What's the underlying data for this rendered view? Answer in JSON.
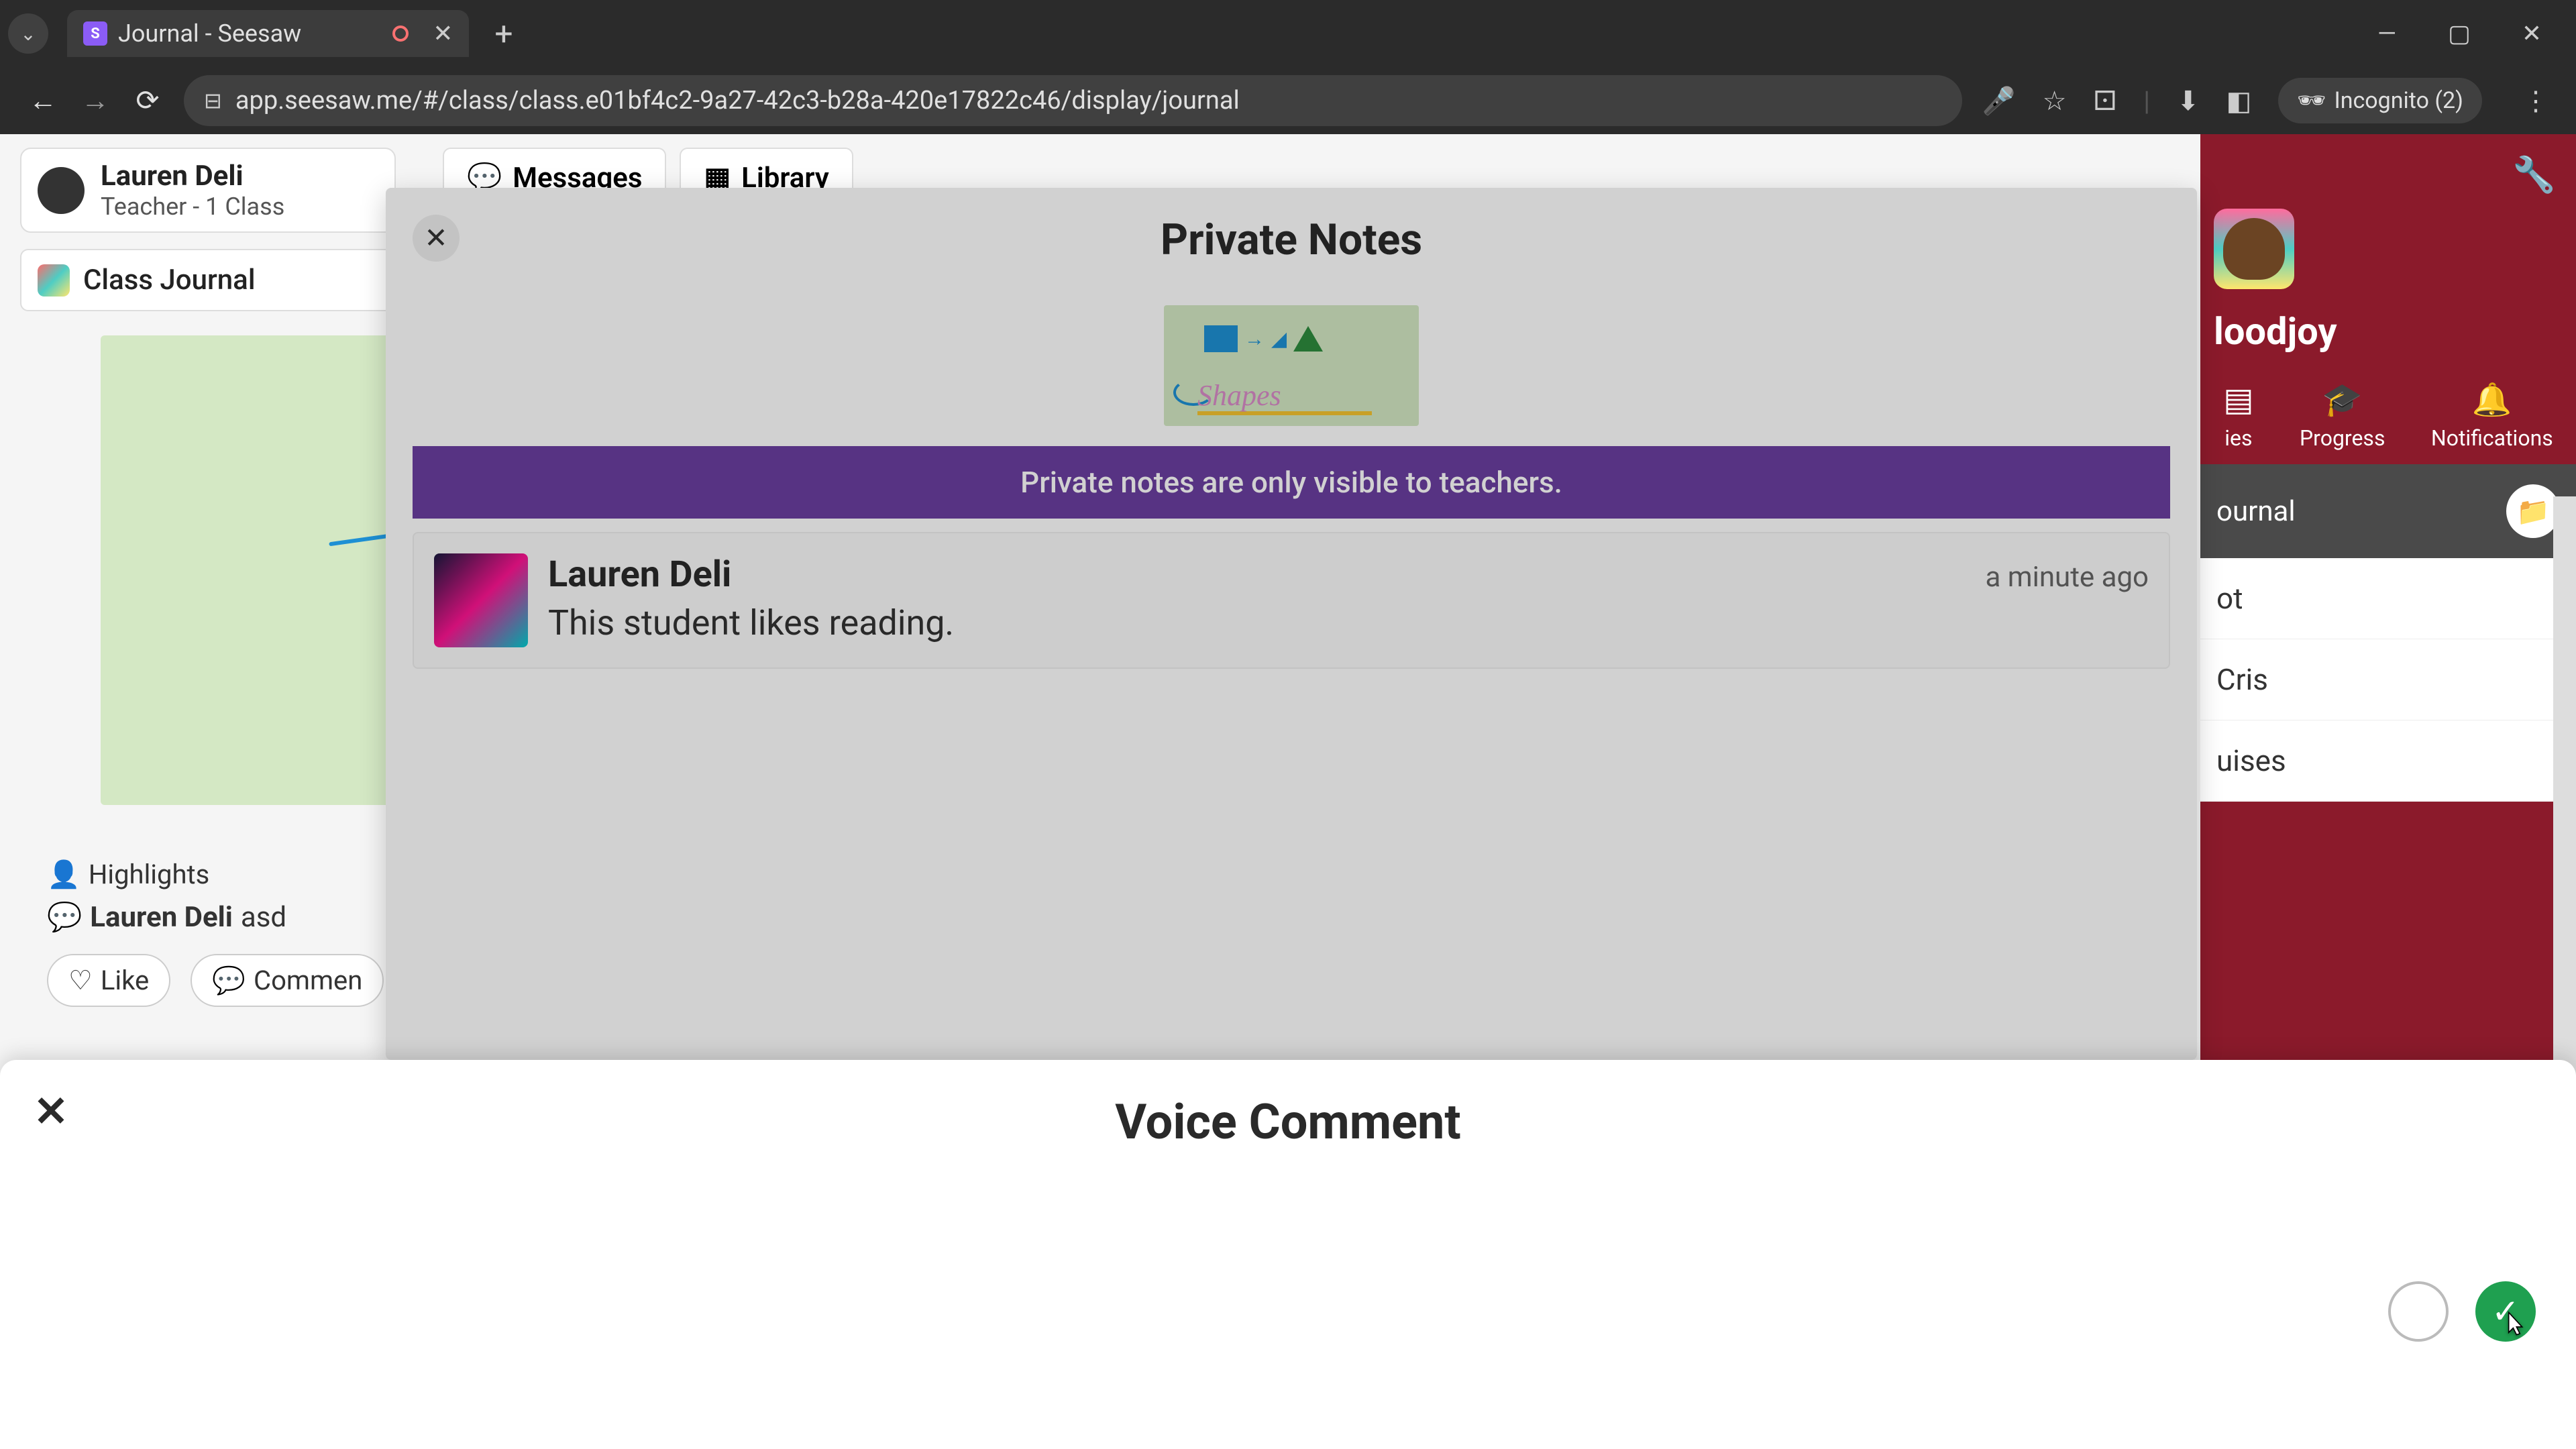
{
  "browser": {
    "tab_title": "Journal - Seesaw",
    "url": "app.seesaw.me/#/class/class.e01bf4c2-9a27-42c3-b28a-420e17822c46/display/journal",
    "incognito_label": "Incognito (2)"
  },
  "user": {
    "name": "Lauren Deli",
    "role": "Teacher - 1 Class"
  },
  "journal_label": "Class Journal",
  "top_tabs": {
    "messages": "Messages",
    "library": "Library"
  },
  "post": {
    "highlights": "Highlights",
    "comment_author": "Lauren Deli",
    "comment_text": "asd",
    "like": "Like",
    "comment": "Commen"
  },
  "right": {
    "class_name": "loodjoy",
    "nav": {
      "activities": "ies",
      "progress": "Progress",
      "notifications": "Notifications"
    },
    "journal": "ournal",
    "students": [
      "ot",
      "Cris",
      "uises"
    ]
  },
  "modal": {
    "title": "Private Notes",
    "thumb_label": "Shapes",
    "banner": "Private notes are only visible to teachers.",
    "note": {
      "author": "Lauren Deli",
      "time": "a minute ago",
      "text": "This student likes reading."
    }
  },
  "sheet": {
    "title": "Voice Comment"
  }
}
